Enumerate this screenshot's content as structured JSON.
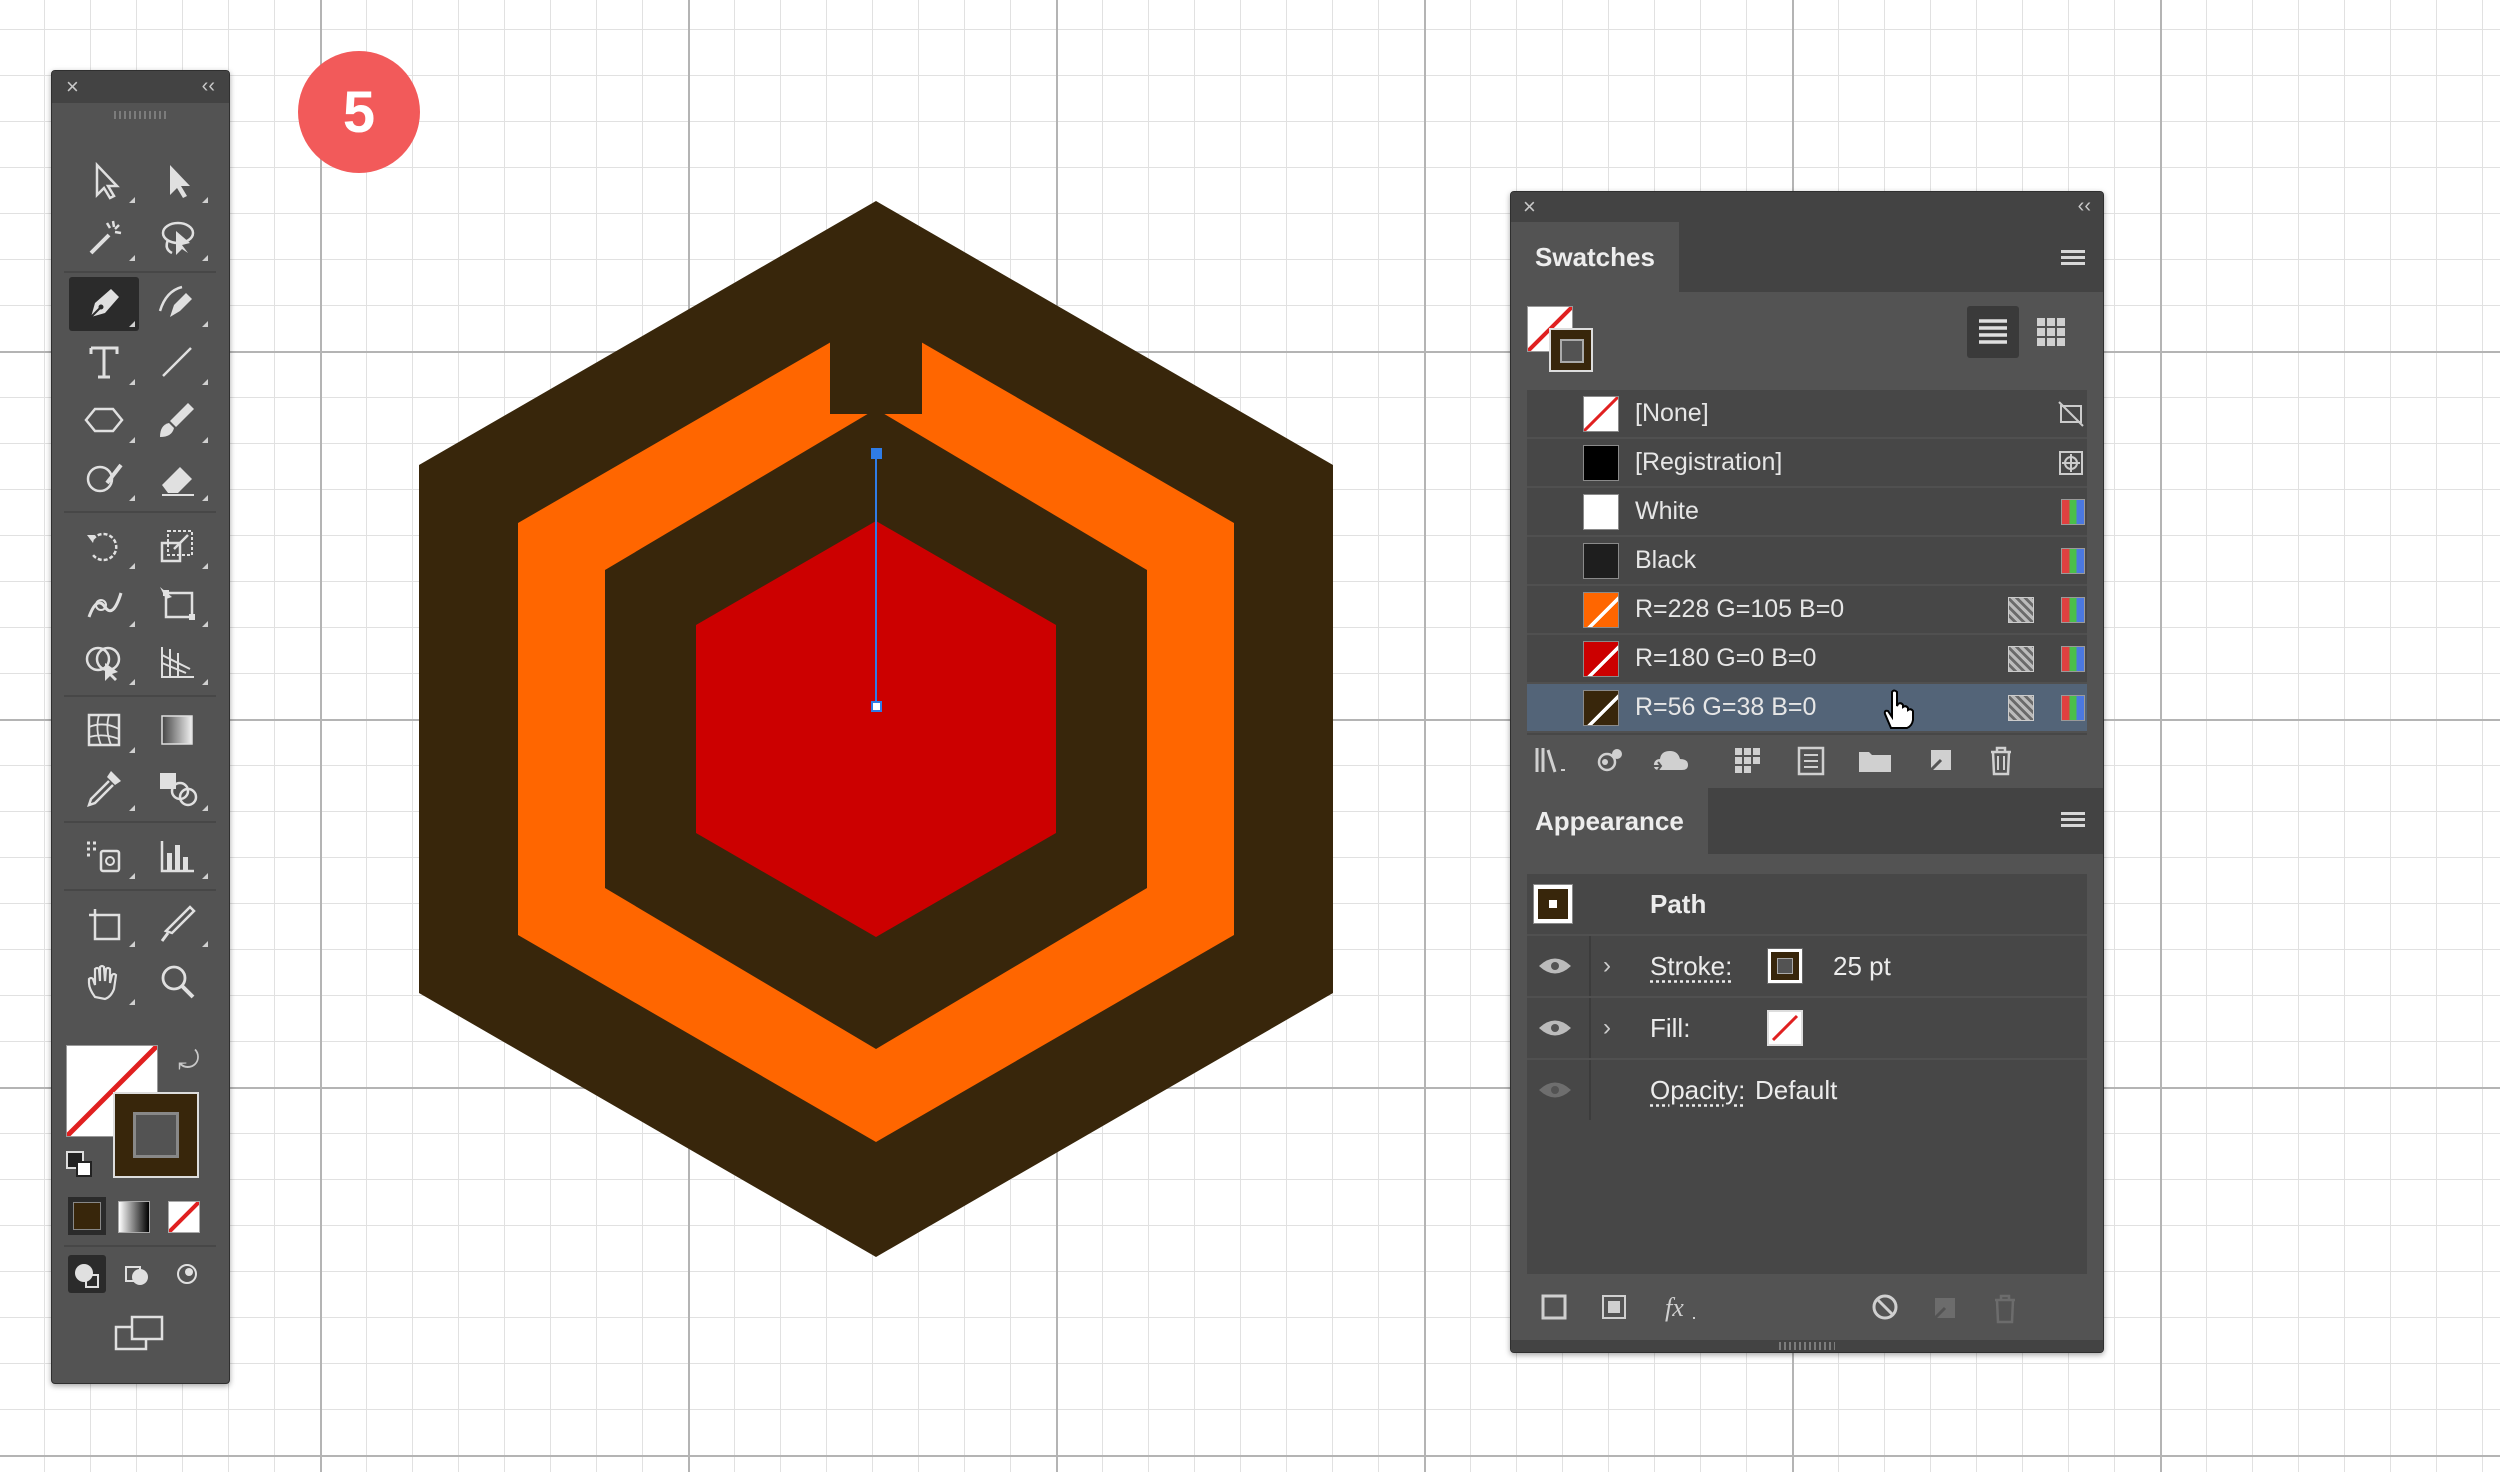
{
  "step_badge": "5",
  "colors": {
    "dark_brown": "#38260b",
    "orange": "#ff6600",
    "red": "#cc0000",
    "anchor_blue": "#2f7ce6",
    "panel_bg": "#535353",
    "row_selected": "#536478"
  },
  "tools_panel": {
    "close_glyph": "×",
    "collapse_glyph": "‹‹",
    "active_tool": "pen-tool",
    "fill_swatch": "none",
    "stroke_swatch": "#38260b"
  },
  "swatches_panel": {
    "title": "Swatches",
    "close_glyph": "×",
    "collapse_glyph": "‹‹",
    "items": [
      {
        "name": "[None]",
        "color": "none"
      },
      {
        "name": "[Registration]",
        "color": "#000000"
      },
      {
        "name": "White",
        "color": "#ffffff"
      },
      {
        "name": "Black",
        "color": "#1e1e1e"
      },
      {
        "name": "R=228 G=105 B=0",
        "color": "#ff6600"
      },
      {
        "name": "R=180 G=0 B=0",
        "color": "#cc0000"
      },
      {
        "name": "R=56 G=38 B=0",
        "color": "#38260b",
        "selected": true
      }
    ]
  },
  "appearance_panel": {
    "title": "Appearance",
    "object_type": "Path",
    "stroke_label": "Stroke:",
    "stroke_value": "25 pt",
    "fill_label": "Fill:",
    "opacity_label": "Opacity:",
    "opacity_value": "Default"
  }
}
